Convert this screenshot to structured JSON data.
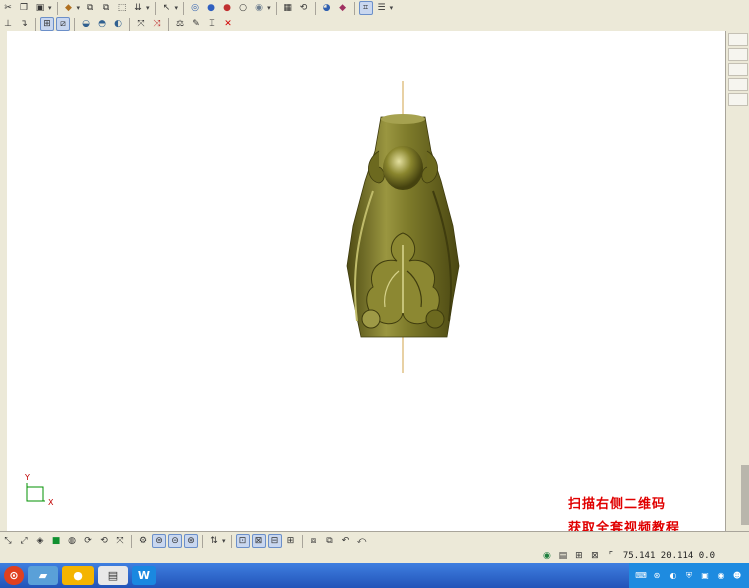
{
  "toolbar_top": {
    "icons": [
      "cut-icon",
      "copy-icon",
      "paste-icon",
      "box-icon",
      "export-icon",
      "import-icon",
      "save-icon",
      "layer-icon",
      "pointer-icon",
      "sphere-icon",
      "sphere-red-icon",
      "sphere-outline-icon",
      "sphere-gray-icon",
      "cube-icon",
      "rotate-icon",
      "render-icon",
      "light-icon",
      "grid-icon"
    ]
  },
  "toolbar_second": {
    "icons": [
      "axis-icon",
      "snap-icon",
      "grid-icon",
      "select-icon",
      "view-front-icon",
      "view-top-icon",
      "view-side-icon",
      "pick-icon",
      "flip-icon",
      "measure-icon",
      "edit-icon",
      "text-icon",
      "delete-icon"
    ]
  },
  "toolbar_bottom": {
    "icons": [
      "tool-1-icon",
      "tool-2-icon",
      "tool-3-icon",
      "tool-4-icon",
      "tool-5-icon",
      "tool-6-icon",
      "tool-7-icon",
      "tool-8-icon",
      "tool-9-icon",
      "tool-10-icon",
      "tool-11-icon",
      "tool-12-icon",
      "tool-13-icon",
      "tool-14-icon",
      "tool-15-icon",
      "tool-16-icon",
      "tool-17-icon",
      "tool-18-icon",
      "undo-icon",
      "redo-icon"
    ]
  },
  "viewport": {
    "axis_x": "X",
    "axis_y": "Y",
    "model_color": "#7d7a2a",
    "model_shade": "#4f4c14",
    "model_highlight": "#c9c57a",
    "axis_line_color": "#d2a34a"
  },
  "watermark": {
    "line1": "扫描右侧二维码",
    "line2": "获取全套视频教程"
  },
  "status": {
    "coords": "75.141 20.114 0.0"
  },
  "taskbar": {
    "apps": [
      "browser-app",
      "explorer-app",
      "chat-app",
      "document-app",
      "wps-app"
    ],
    "wps_label": "W"
  }
}
